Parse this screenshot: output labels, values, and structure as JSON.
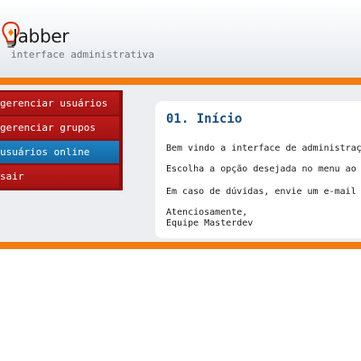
{
  "header": {
    "brand": "Jabber",
    "tagline": "interface administrativa"
  },
  "menu": {
    "items": [
      {
        "label": "gerenciar usuários"
      },
      {
        "label": "gerenciar grupos"
      },
      {
        "label": "usuários online",
        "active": true
      },
      {
        "label": "sair"
      }
    ]
  },
  "main": {
    "title": "01. Início",
    "lines": [
      "Bem vindo a interface de administração",
      "Escolha a opção desejada no menu ao l",
      "Em caso de dúvidas, envie um e-mail p",
      "Atenciosamente,",
      "Equipe Masterdev"
    ]
  },
  "colors": {
    "orange": "#f37b12",
    "menu_red": "#a51313",
    "menu_active_blue": "#1268a4",
    "title_blue": "#1e4e7a"
  }
}
